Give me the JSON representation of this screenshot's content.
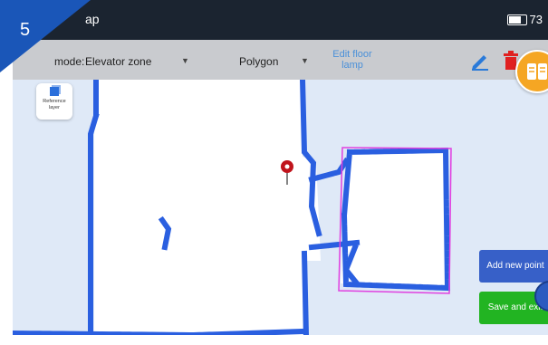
{
  "step_badge": "5",
  "statusbar": {
    "title_fragment": "ap",
    "battery_text": "73"
  },
  "toolbar": {
    "mode_label": "mode:",
    "zone_value": "Elevator zone",
    "shape_value": "Polygon",
    "edit_label_line1": "Edit floor",
    "edit_label_line2": "lamp"
  },
  "reference_layer": {
    "line1": "Reference",
    "line2": "layer"
  },
  "buttons": {
    "add_point": "Add new point",
    "save_exit": "Save and exit"
  },
  "colors": {
    "wall_blue": "#2a5fe0",
    "polygon_magenta": "#e040e0",
    "add_button": "#3760c8",
    "save_button": "#22b422",
    "badge_blue": "#1a56b8",
    "toolbar_grey": "#c9cbcf",
    "status_dark": "#1b2430"
  },
  "icons": [
    "pencil-icon",
    "trash-icon",
    "book-icon",
    "location-pin-icon",
    "reference-layer-icon",
    "battery-icon",
    "dropdown-arrow-icon"
  ]
}
